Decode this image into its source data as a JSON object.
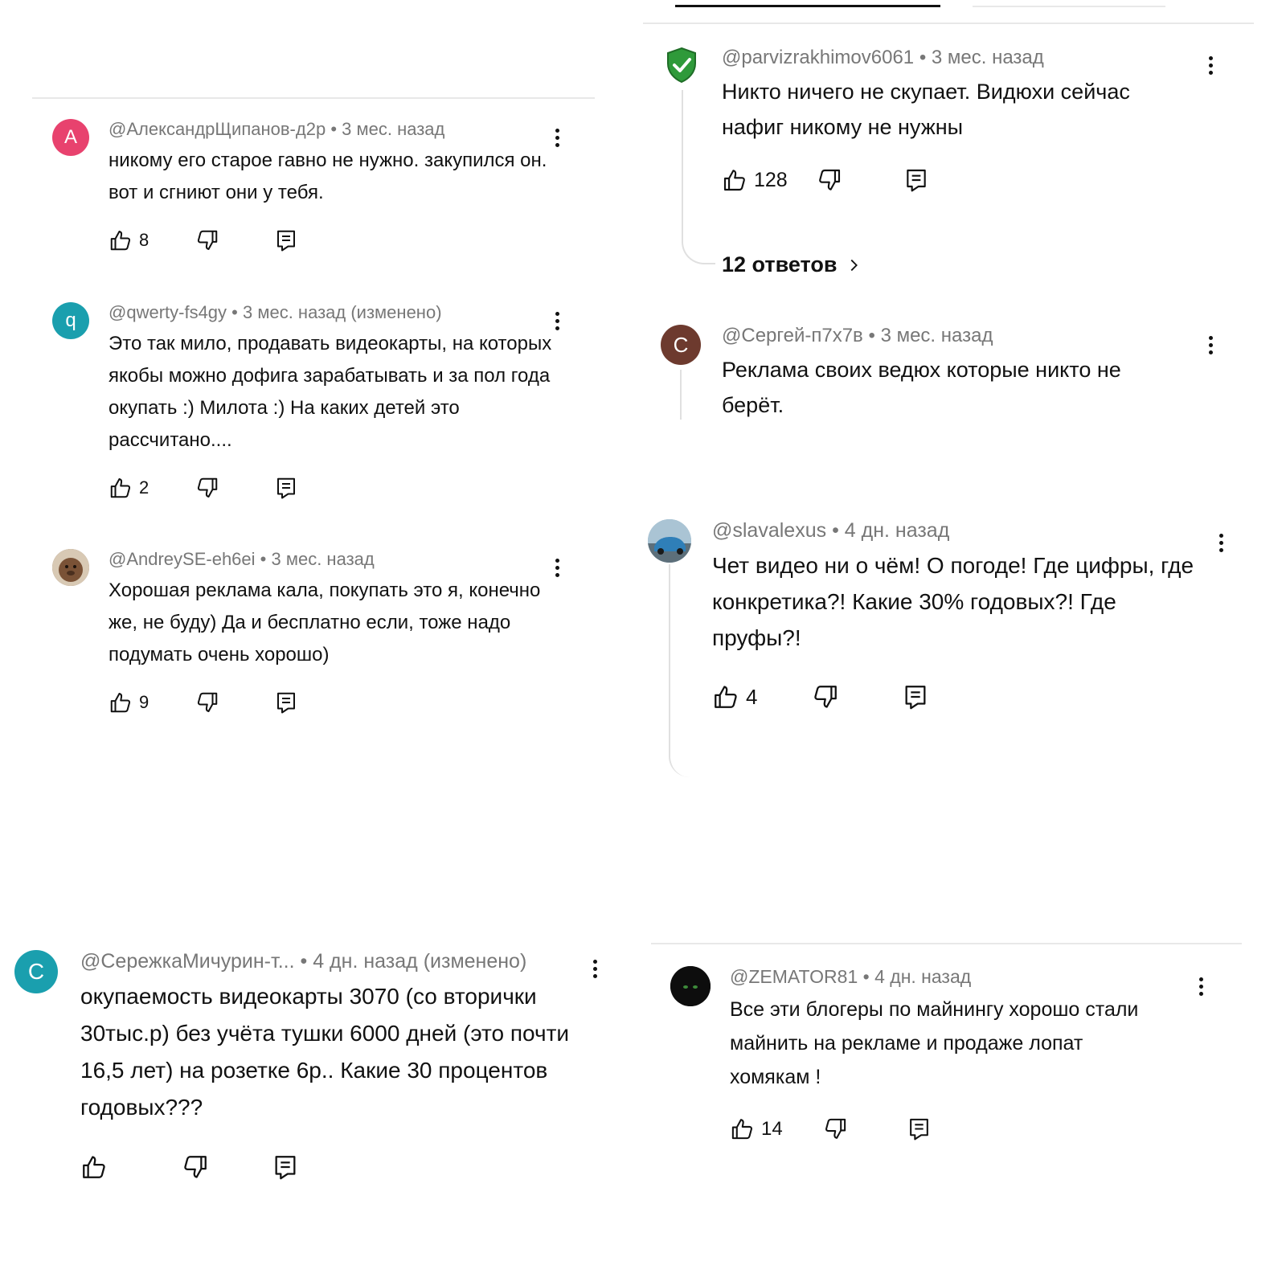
{
  "left_top": {
    "comments": [
      {
        "avatar_letter": "А",
        "author": "@АлександрЩипанов-д2р",
        "time": "3 мес. назад",
        "edited": "",
        "text": "никому его старое гавно не нужно. закупился он. вот и сгниют они у тебя.",
        "likes": "8"
      },
      {
        "avatar_letter": "q",
        "author": "@qwerty-fs4gy",
        "time": "3 мес. назад",
        "edited": "(изменено)",
        "text": "Это так мило, продавать видеокарты, на которых якобы можно дофига зарабатывать и за пол года окупать :) Милота :) На каких детей это рассчитано....",
        "likes": "2"
      },
      {
        "avatar_letter": "",
        "author": "@AndreySE-eh6ei",
        "time": "3 мес. назад",
        "edited": "",
        "text": "Хорошая реклама кала, покупать это я, конечно же, не буду) Да и бесплатно если, тоже надо подумать очень хорошо)",
        "likes": "9"
      }
    ]
  },
  "right_top": {
    "comment1": {
      "author": "@parvizrakhimov6061",
      "time": "3 мес. назад",
      "text": "Никто ничего не скупает. Видюхи сейчас нафиг никому не нужны",
      "likes": "128"
    },
    "replies_link": "12 ответов",
    "comment2": {
      "avatar_letter": "С",
      "author": "@Сергей-п7х7в",
      "time": "3 мес. назад",
      "text": "Реклама своих ведюх которые никто не берёт."
    }
  },
  "right_middle": {
    "author": "@slavalexus",
    "time": "4 дн. назад",
    "text": "Чет видео ни о чём! О погоде! Где цифры, где конкретика?! Какие 30% годовых?! Где пруфы?!",
    "likes": "4"
  },
  "left_bottom": {
    "avatar_letter": "С",
    "author": "@СережкаМичурин-т...",
    "time": "4 дн. назад",
    "edited": "(изменено)",
    "text": "окупаемость видеокарты 3070 (со вторички 30тыс.р) без учёта тушки 6000 дней (это почти 16,5 лет) на розетке 6р.. Какие 30 процентов годовых???"
  },
  "right_bottom": {
    "author": "@ZEMATOR81",
    "time": "4 дн. назад",
    "text": "Все эти блогеры по майнингу хорошо стали майнить на рекламе и продаже лопат хомякам !",
    "likes": "14"
  },
  "separator": "•",
  "colors": {
    "avatar_pink": "#e8426e",
    "avatar_teal": "#1a9fae",
    "avatar_brown": "#6d3a2e",
    "meta_gray": "#777777",
    "divider": "#e8e8e8"
  },
  "icons": [
    "like-icon",
    "dislike-icon",
    "reply-icon",
    "more-vert-icon",
    "chevron-right-icon",
    "shield-check-icon"
  ]
}
